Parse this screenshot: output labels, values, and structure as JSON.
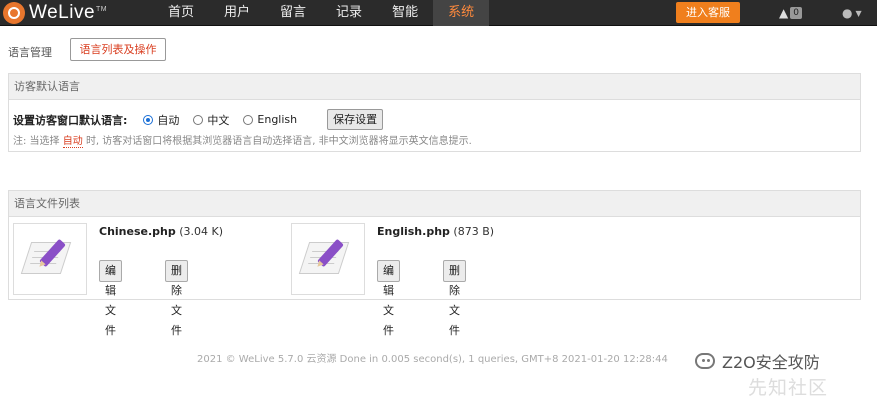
{
  "header": {
    "logo_text": "WeLive",
    "logo_tm": "TM",
    "nav": [
      {
        "label": "首页"
      },
      {
        "label": "用户"
      },
      {
        "label": "留言"
      },
      {
        "label": "记录"
      },
      {
        "label": "智能"
      },
      {
        "label": "系统",
        "active": true
      }
    ],
    "service_button": "进入客服",
    "alert_icon": "warning-icon",
    "alert_count": "0",
    "user_icon": "user-icon"
  },
  "breadcrumb": {
    "label": "语言管理",
    "tab_button": "语言列表及操作"
  },
  "default_language_panel": {
    "title": "访客默认语言",
    "setting_label": "设置访客窗口默认语言:",
    "options": [
      {
        "label": "自动",
        "selected": true
      },
      {
        "label": "中文",
        "selected": false
      },
      {
        "label": "English",
        "selected": false
      }
    ],
    "save_button": "保存设置",
    "note_prefix": "注: 当选择",
    "note_highlight": "自动",
    "note_suffix": "时, 访客对话窗口将根据其浏览器语言自动选择语言, 非中文浏览器将显示英文信息提示."
  },
  "file_list_panel": {
    "title": "语言文件列表",
    "files": [
      {
        "name": "Chinese.php",
        "size": "(3.04 K)",
        "edit_button": "编辑文件",
        "delete_button": "删除文件"
      },
      {
        "name": "English.php",
        "size": "(873 B)",
        "edit_button": "编辑文件",
        "delete_button": "删除文件"
      }
    ]
  },
  "footer": {
    "text": "2021 © WeLive 5.7.0 云资源 Done in 0.005 second(s), 1 queries, GMT+8 2021-01-20 12:28:44"
  },
  "watermark": {
    "line1": "Z2O安全攻防",
    "line2": "先知社区"
  },
  "colors": {
    "topbar": "#2b2b2b",
    "accent": "#f07f1d",
    "active_nav": "#ff8a3d",
    "highlight": "#d93d1f"
  }
}
